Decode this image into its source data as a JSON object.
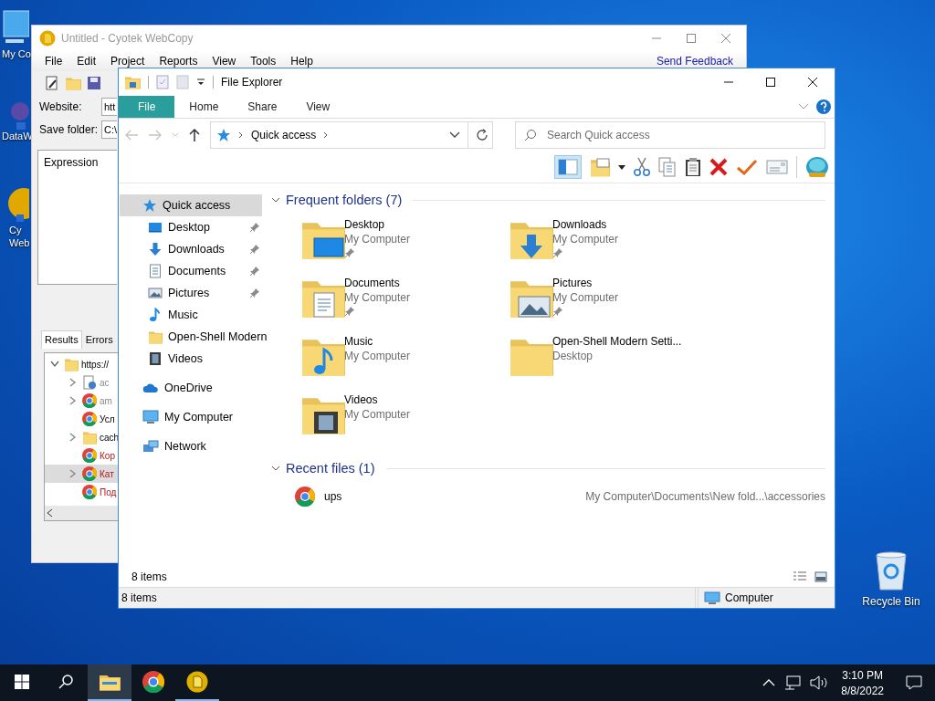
{
  "desktop_icons": [
    {
      "kind": "computer",
      "lines": [
        "My Co"
      ]
    },
    {
      "kind": "app",
      "lines": [
        "DataW"
      ]
    },
    {
      "kind": "webcopy",
      "lines": [
        "Cy",
        "Web"
      ]
    }
  ],
  "recycle_bin": {
    "label": "Recycle Bin"
  },
  "webcopy": {
    "title": "Untitled - Cyotek WebCopy",
    "menu": [
      "File",
      "Edit",
      "Project",
      "Reports",
      "View",
      "Tools",
      "Help"
    ],
    "send_feedback": "Send Feedback",
    "website_label": "Website:",
    "website_value": "htt",
    "save_folder_label": "Save folder:",
    "save_folder_value": "C:\\",
    "expression_header": "Expression",
    "tabs": [
      {
        "label": "Results",
        "selected": true
      },
      {
        "label": "Errors",
        "selected": false
      }
    ],
    "tree": [
      {
        "label": "https://",
        "kind": "folder",
        "failed": false,
        "skipped": false,
        "selected": false,
        "expanded": true,
        "children": [
          {
            "label": "ac",
            "kind": "page",
            "failed": false,
            "skipped": true,
            "selected": false,
            "expandable": true
          },
          {
            "label": "am",
            "kind": "chrome",
            "failed": false,
            "skipped": true,
            "selected": false,
            "expandable": true
          },
          {
            "label": "Усл",
            "kind": "chrome",
            "failed": false,
            "skipped": false,
            "selected": false,
            "expandable": false
          },
          {
            "label": "cach",
            "kind": "folder",
            "failed": false,
            "skipped": false,
            "selected": false,
            "expandable": true
          },
          {
            "label": "Кор",
            "kind": "chrome",
            "failed": true,
            "skipped": false,
            "selected": false,
            "expandable": false
          },
          {
            "label": "Кат",
            "kind": "chrome",
            "failed": true,
            "skipped": false,
            "selected": true,
            "expandable": true
          },
          {
            "label": "Под",
            "kind": "chrome",
            "failed": true,
            "skipped": false,
            "selected": false,
            "expandable": false
          }
        ]
      }
    ]
  },
  "explorer": {
    "title": "File Explorer",
    "ribbon_tabs": [
      {
        "label": "File",
        "selected": true
      },
      {
        "label": "Home",
        "selected": false
      },
      {
        "label": "Share",
        "selected": false
      },
      {
        "label": "View",
        "selected": false
      }
    ],
    "address": "Quick access",
    "search": {
      "placeholder": "Search Quick access"
    },
    "nav": [
      {
        "label": "Quick access",
        "kind": "quick",
        "selected": true,
        "children": [
          {
            "label": "Desktop",
            "kind": "desktop",
            "pinned": true,
            "selected": false
          },
          {
            "label": "Downloads",
            "kind": "downloads",
            "pinned": true,
            "selected": false
          },
          {
            "label": "Documents",
            "kind": "documents",
            "pinned": true,
            "selected": false
          },
          {
            "label": "Pictures",
            "kind": "pictures",
            "pinned": true,
            "selected": false
          },
          {
            "label": "Music",
            "kind": "music",
            "pinned": false,
            "selected": false
          },
          {
            "label": "Open-Shell Modern",
            "kind": "folder",
            "pinned": false,
            "selected": false
          },
          {
            "label": "Videos",
            "kind": "videos",
            "pinned": false,
            "selected": false
          }
        ]
      },
      {
        "label": "OneDrive",
        "kind": "onedrive",
        "selected": false
      },
      {
        "label": "My Computer",
        "kind": "computer",
        "selected": false
      },
      {
        "label": "Network",
        "kind": "network",
        "selected": false
      }
    ],
    "frequent": {
      "heading": "Frequent folders (7)",
      "items": [
        {
          "name": "Desktop",
          "location": "My Computer",
          "kind": "desktop",
          "pinned": true
        },
        {
          "name": "Downloads",
          "location": "My Computer",
          "kind": "downloads",
          "pinned": true
        },
        {
          "name": "Documents",
          "location": "My Computer",
          "kind": "documents",
          "pinned": true
        },
        {
          "name": "Pictures",
          "location": "My Computer",
          "kind": "pictures",
          "pinned": true
        },
        {
          "name": "Music",
          "location": "My Computer",
          "kind": "music",
          "pinned": false
        },
        {
          "name": "Open-Shell Modern Setti...",
          "location": "Desktop",
          "kind": "folder",
          "pinned": false
        },
        {
          "name": "Videos",
          "location": "My Computer",
          "kind": "videos",
          "pinned": false
        }
      ]
    },
    "recent": {
      "heading": "Recent files (1)",
      "items": [
        {
          "name": "ups",
          "path": "My Computer\\Documents\\New fold...\\accessories"
        }
      ]
    },
    "item_count": "8 items",
    "status_bar": {
      "count": "8 items",
      "location": "Computer"
    }
  },
  "taskbar": {
    "items": [
      {
        "kind": "start",
        "active": false,
        "running": false
      },
      {
        "kind": "search",
        "active": false,
        "running": false
      },
      {
        "kind": "explorer",
        "active": true,
        "running": true
      },
      {
        "kind": "chrome",
        "active": false,
        "running": false
      },
      {
        "kind": "webcopy",
        "active": false,
        "running": true
      }
    ],
    "time": "3:10 PM",
    "date": "8/8/2022"
  }
}
